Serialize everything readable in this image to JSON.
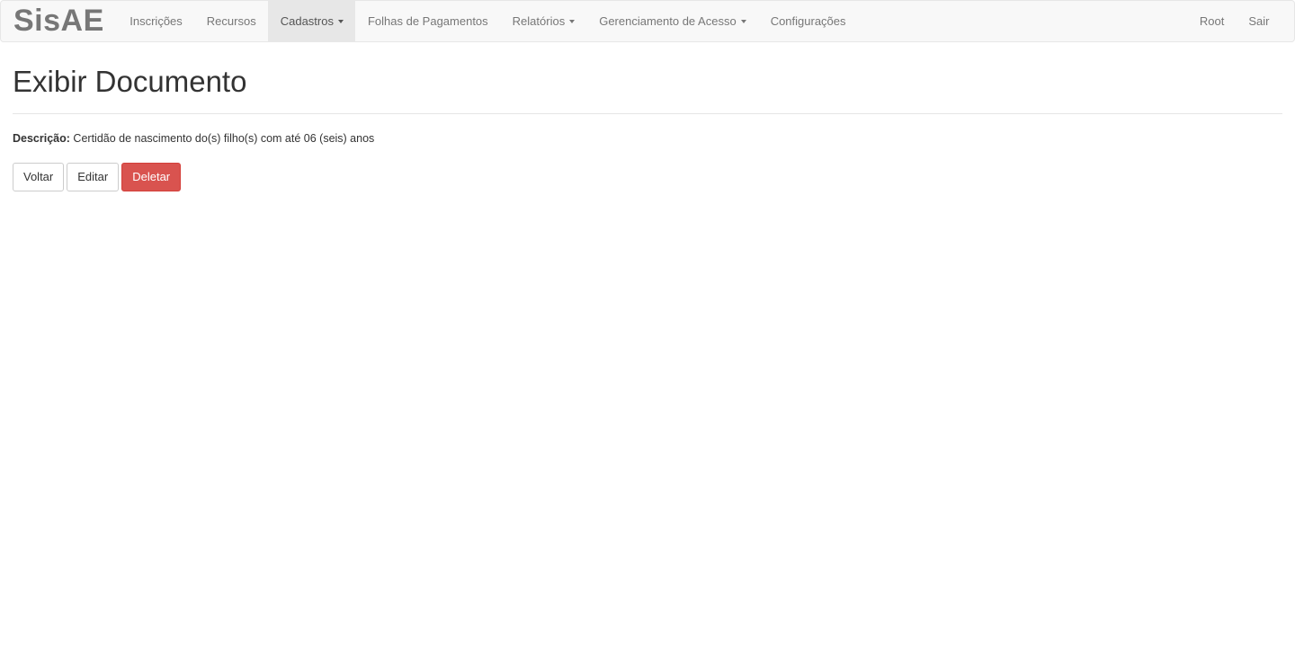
{
  "navbar": {
    "brand": "SisAE",
    "items": [
      {
        "label": "Inscrições",
        "dropdown": false
      },
      {
        "label": "Recursos",
        "dropdown": false
      },
      {
        "label": "Cadastros",
        "dropdown": true,
        "active": true
      },
      {
        "label": "Folhas de Pagamentos",
        "dropdown": false
      },
      {
        "label": "Relatórios",
        "dropdown": true
      },
      {
        "label": "Gerenciamento de Acesso",
        "dropdown": true
      },
      {
        "label": "Configurações",
        "dropdown": false
      }
    ],
    "right_items": [
      {
        "label": "Root"
      },
      {
        "label": "Sair"
      }
    ]
  },
  "page": {
    "title": "Exibir Documento",
    "field_label": "Descrição:",
    "field_value": "Certidão de nascimento do(s) filho(s) com até 06 (seis) anos"
  },
  "actions": {
    "back_label": "Voltar",
    "edit_label": "Editar",
    "delete_label": "Deletar"
  },
  "colors": {
    "navbar_bg": "#f8f8f8",
    "nav_active_bg": "#e7e7e7",
    "danger": "#d9534f"
  }
}
